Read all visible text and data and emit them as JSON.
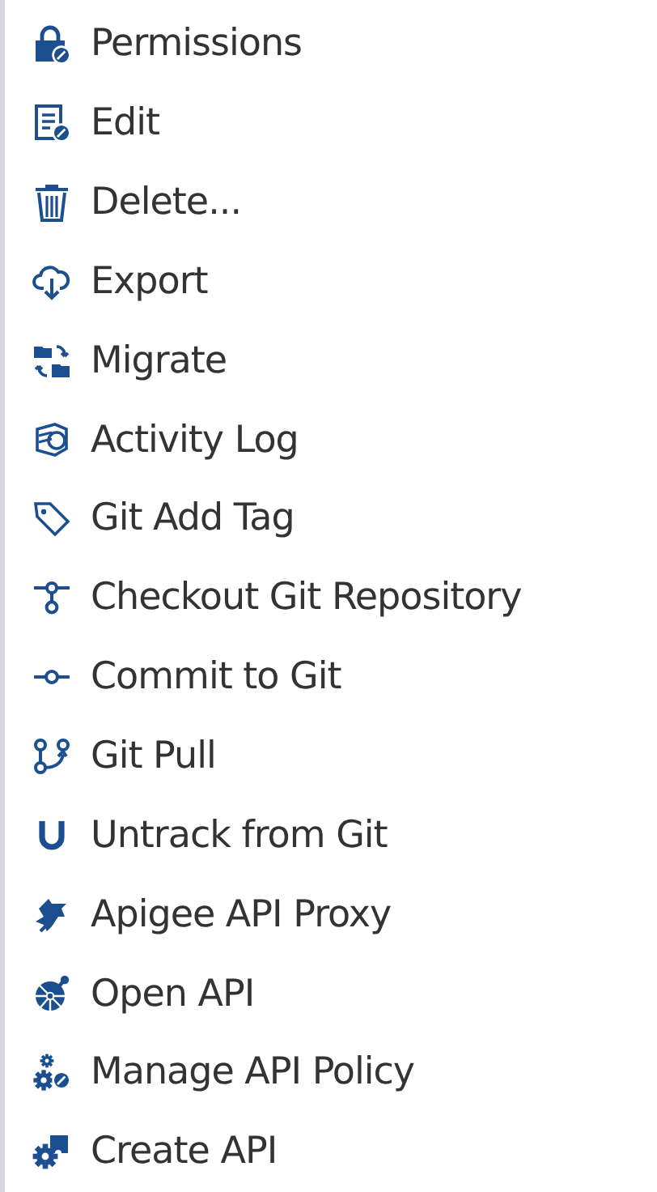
{
  "menu": {
    "items": [
      {
        "label": "Permissions"
      },
      {
        "label": "Edit"
      },
      {
        "label": "Delete..."
      },
      {
        "label": "Export"
      },
      {
        "label": "Migrate"
      },
      {
        "label": "Activity Log"
      },
      {
        "label": "Git Add Tag"
      },
      {
        "label": "Checkout Git Repository"
      },
      {
        "label": "Commit to Git"
      },
      {
        "label": "Git Pull"
      },
      {
        "label": "Untrack from Git"
      },
      {
        "label": "Apigee API Proxy"
      },
      {
        "label": "Open API"
      },
      {
        "label": "Manage API Policy"
      },
      {
        "label": "Create API"
      }
    ]
  }
}
